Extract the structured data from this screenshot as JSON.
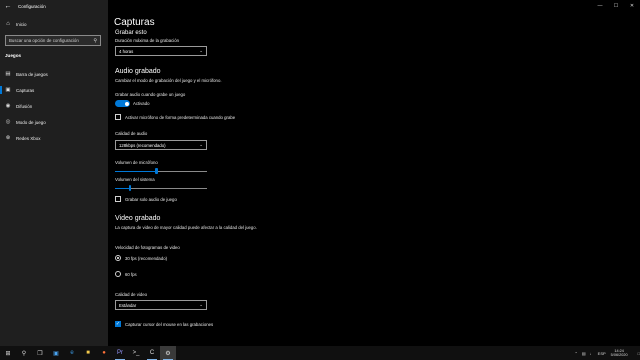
{
  "window": {
    "title": "Configuración",
    "back_icon": "back-arrow-icon",
    "controls": [
      "—",
      "☐",
      "✕"
    ]
  },
  "sidebar": {
    "home_label": "Inicio",
    "home_icon": "home-icon",
    "search_placeholder": "Buscar una opción de configuración",
    "search_icon": "search-icon",
    "section": "Juegos",
    "items": [
      {
        "label": "Barra de juegos",
        "icon": "game-bar-icon"
      },
      {
        "label": "Capturas",
        "icon": "captures-icon"
      },
      {
        "label": "Difusión",
        "icon": "broadcast-icon"
      },
      {
        "label": "Modo de juego",
        "icon": "game-mode-icon"
      },
      {
        "label": "Redes Xbox",
        "icon": "xbox-icon"
      }
    ],
    "active_index": 1
  },
  "main": {
    "page_title": "Capturas",
    "record_this": {
      "heading": "Grabar esto",
      "max_duration_label": "Duración máxima de la grabación",
      "max_duration_value": "4 horas"
    },
    "audio": {
      "heading": "Audio grabado",
      "description": "Cambiar el modo de grabación del juego y el micrófono.",
      "record_audio_label": "Grabar audio cuando grabe un juego",
      "record_audio_state": "Activado",
      "mic_default_label": "Activar micrófono de forma predeterminada cuando grabe",
      "quality_label": "Calidad de audio",
      "quality_value": "128kbps (recomendado)",
      "mic_volume_label": "Volumen de micrófono",
      "mic_volume": 0.45,
      "system_volume_label": "Volumen del sistema",
      "system_volume": 0.16,
      "game_audio_only_label": "Grabar solo audio de juego"
    },
    "video": {
      "heading": "Video grabado",
      "description": "La captura de video de mayor calidad puede afectar a la calidad del juego.",
      "fps_label": "Velocidad de fotogramas de video",
      "fps_options": [
        "30 fps (recomendado)",
        "60 fps"
      ],
      "fps_selected_index": 0,
      "quality_label": "Calidad de video",
      "quality_value": "Estándar",
      "capture_cursor_label": "Capturar cursor del mouse en las grabaciones"
    }
  },
  "taskbar": {
    "icons": [
      "windows-start-icon",
      "search-icon",
      "task-view-icon",
      "photos-icon",
      "edge-icon",
      "file-explorer-icon",
      "firefox-icon",
      "premiere-icon",
      "terminal-icon",
      "app-c-icon",
      "settings-icon"
    ],
    "language": "ESP",
    "time": "14:24",
    "date": "5/06/2020",
    "accent": "#0078d7"
  }
}
